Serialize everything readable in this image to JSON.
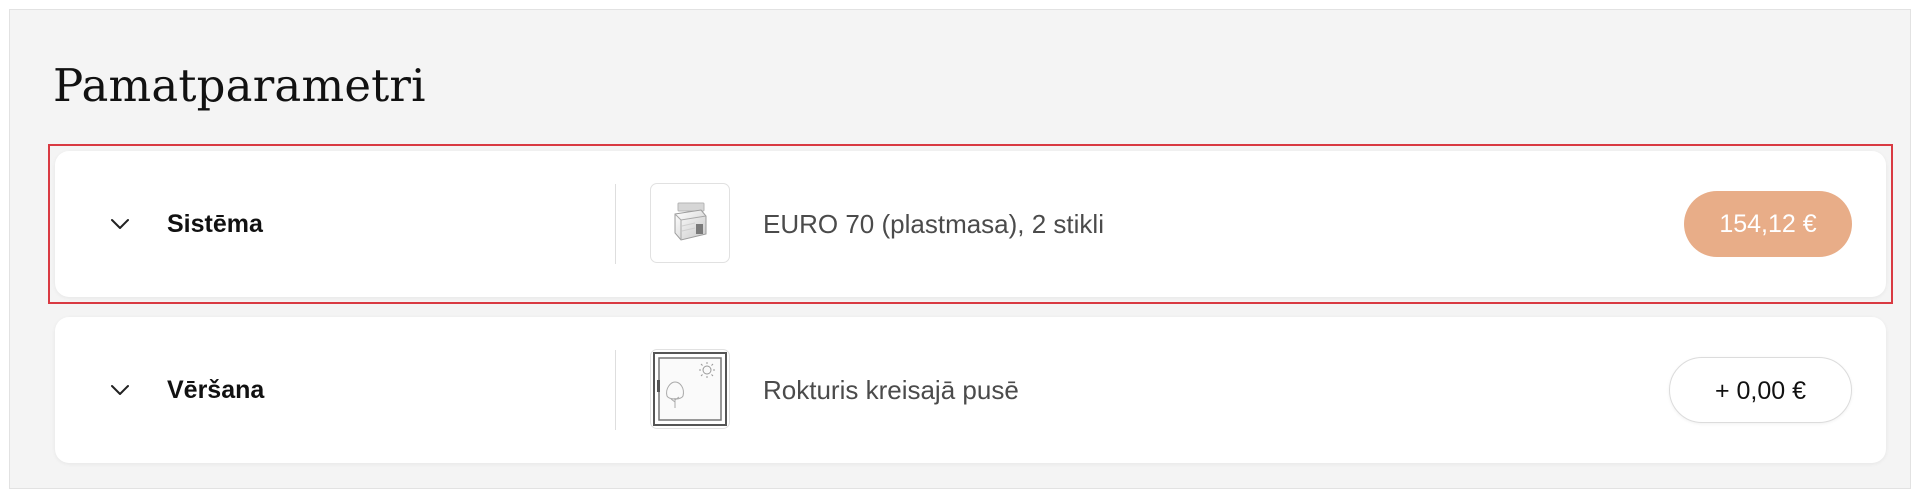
{
  "section": {
    "title": "Pamatparametri"
  },
  "rows": [
    {
      "label": "Sistēma",
      "value": "EURO 70 (plastmasa), 2 stikli",
      "price": "154,12 €",
      "selected": true,
      "thumbnail": "window-profile-icon",
      "price_color": "#e8ad88"
    },
    {
      "label": "Vēršana",
      "value": "Rokturis kreisajā pusē",
      "price": "+ 0,00 €",
      "selected": false,
      "thumbnail": "window-opening-icon"
    }
  ],
  "colors": {
    "panel_background": "#f4f4f4",
    "highlight_border": "#d93a42",
    "price_selected": "#e8ad88"
  }
}
